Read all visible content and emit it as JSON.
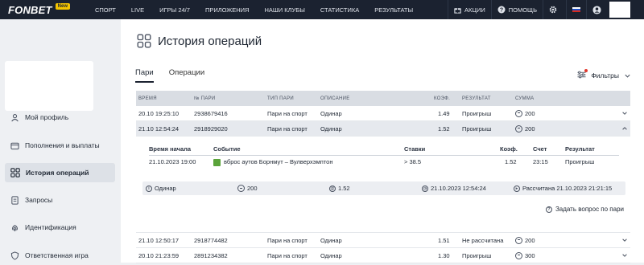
{
  "nav": {
    "logo": "FONBET",
    "badge": "New",
    "links": [
      "СПОРТ",
      "LIVE",
      "ИГРЫ 24/7",
      "ПРИЛОЖЕНИЯ",
      "НАШИ КЛУБЫ",
      "СТАТИСТИКА",
      "РЕЗУЛЬТАТЫ"
    ],
    "promo": "АКЦИИ",
    "help": "ПОМОЩЬ"
  },
  "sidebar": {
    "items": [
      {
        "label": "Мой профиль",
        "icon": "user-icon"
      },
      {
        "label": "Пополнения и выплаты",
        "icon": "wallet-icon"
      },
      {
        "label": "История операций",
        "icon": "grid-icon"
      },
      {
        "label": "Запросы",
        "icon": "document-icon"
      },
      {
        "label": "Идентификация",
        "icon": "fingerprint-icon"
      },
      {
        "label": "Ответственная игра",
        "icon": "shield-icon"
      }
    ]
  },
  "page": {
    "title": "История операций",
    "tabs": [
      "Пари",
      "Операции"
    ],
    "filters": "Фильтры"
  },
  "table": {
    "headers": [
      "ВРЕМЯ",
      "№ ПАРИ",
      "ТИП ПАРИ",
      "ОПИСАНИЕ",
      "КОЭФ.",
      "РЕЗУЛЬТАТ",
      "СУММА"
    ],
    "rows": [
      {
        "time": "20.10 19:25:10",
        "num": "2938679416",
        "type": "Пари на спорт",
        "desc": "Одинар",
        "coef": "1.49",
        "result": "Проигрыш",
        "sum": "200"
      },
      {
        "time": "21.10 12:54:24",
        "num": "2918929020",
        "type": "Пари на спорт",
        "desc": "Одинар",
        "coef": "1.52",
        "result": "Проигрыш",
        "sum": "200"
      },
      {
        "time": "21.10 12:50:17",
        "num": "2918774482",
        "type": "Пари на спорт",
        "desc": "Одинар",
        "coef": "1.51",
        "result": "Не рассчитана",
        "sum": "200"
      },
      {
        "time": "20.10 21:23:59",
        "num": "2891234382",
        "type": "Пари на спорт",
        "desc": "Одинар",
        "coef": "1.30",
        "result": "Проигрыш",
        "sum": "300"
      }
    ],
    "detail": {
      "headers": [
        "Время начала",
        "Событие",
        "Ставки",
        "Коэф.",
        "Счет",
        "Результат"
      ],
      "row": {
        "start": "21.10.2023 19:00",
        "event": "вброс аутов Борнмут – Вулверхэмптон",
        "bet": "> 38.5",
        "coef": "1.52",
        "score": "23:15",
        "result": "Проигрыш"
      },
      "summary": {
        "type": "Одинар",
        "sum": "200",
        "coef": "1.52",
        "placed": "21.10.2023 12:54:24",
        "settled": "Рассчитана 21.10.2023 21:21:15"
      },
      "ask": "Задать вопрос по пари"
    }
  }
}
